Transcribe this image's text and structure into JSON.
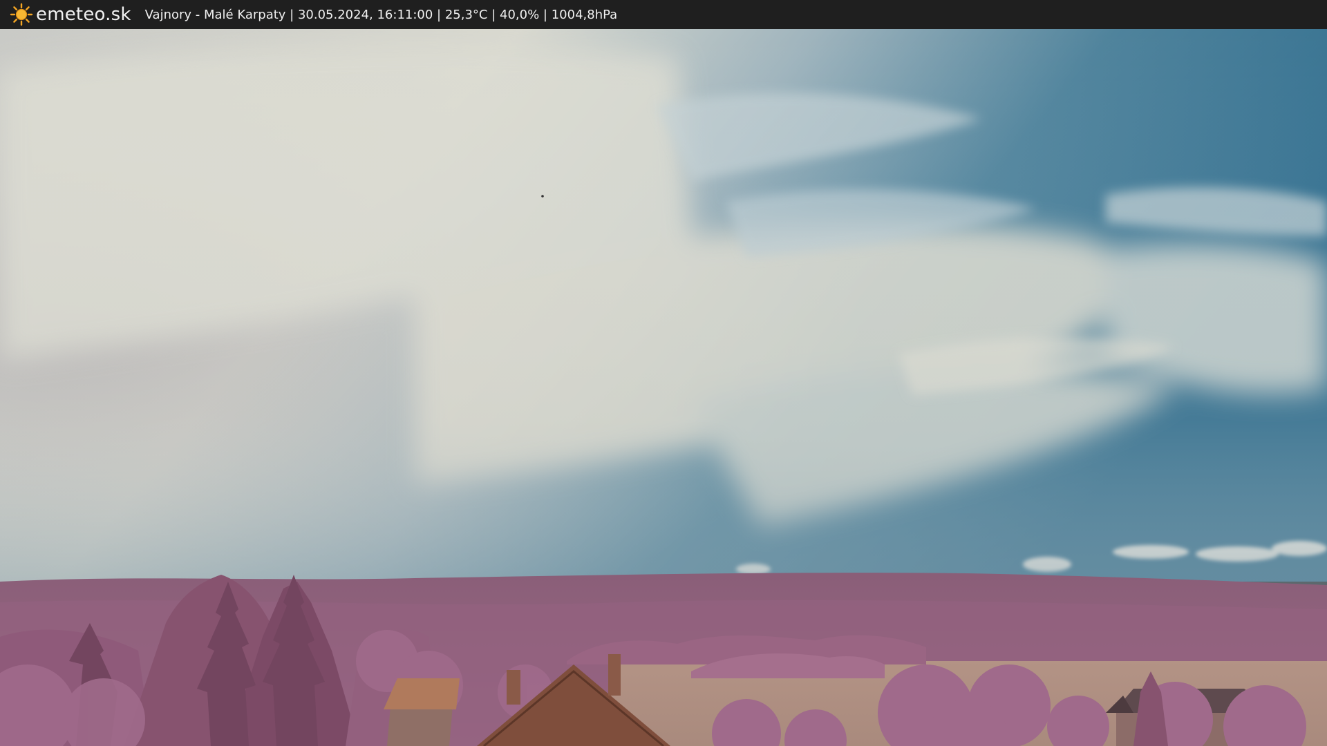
{
  "header": {
    "brand": "emeteo.sk",
    "location": "Vajnory - Malé Karpaty",
    "datetime": "30.05.2024, 16:11:00",
    "temperature": "25,3°C",
    "humidity": "40,0%",
    "pressure": "1004,8hPa",
    "separator": " | ",
    "logo_icon": "sun-icon"
  },
  "colors": {
    "bar_background": "#1f1f1f",
    "sun": "#f5a623",
    "sky_blue": "#3e7fa0",
    "cloud": "#dad9cf",
    "foliage": "#a06a8c",
    "field": "#b89a8c",
    "roof": "#7a4a3a"
  }
}
